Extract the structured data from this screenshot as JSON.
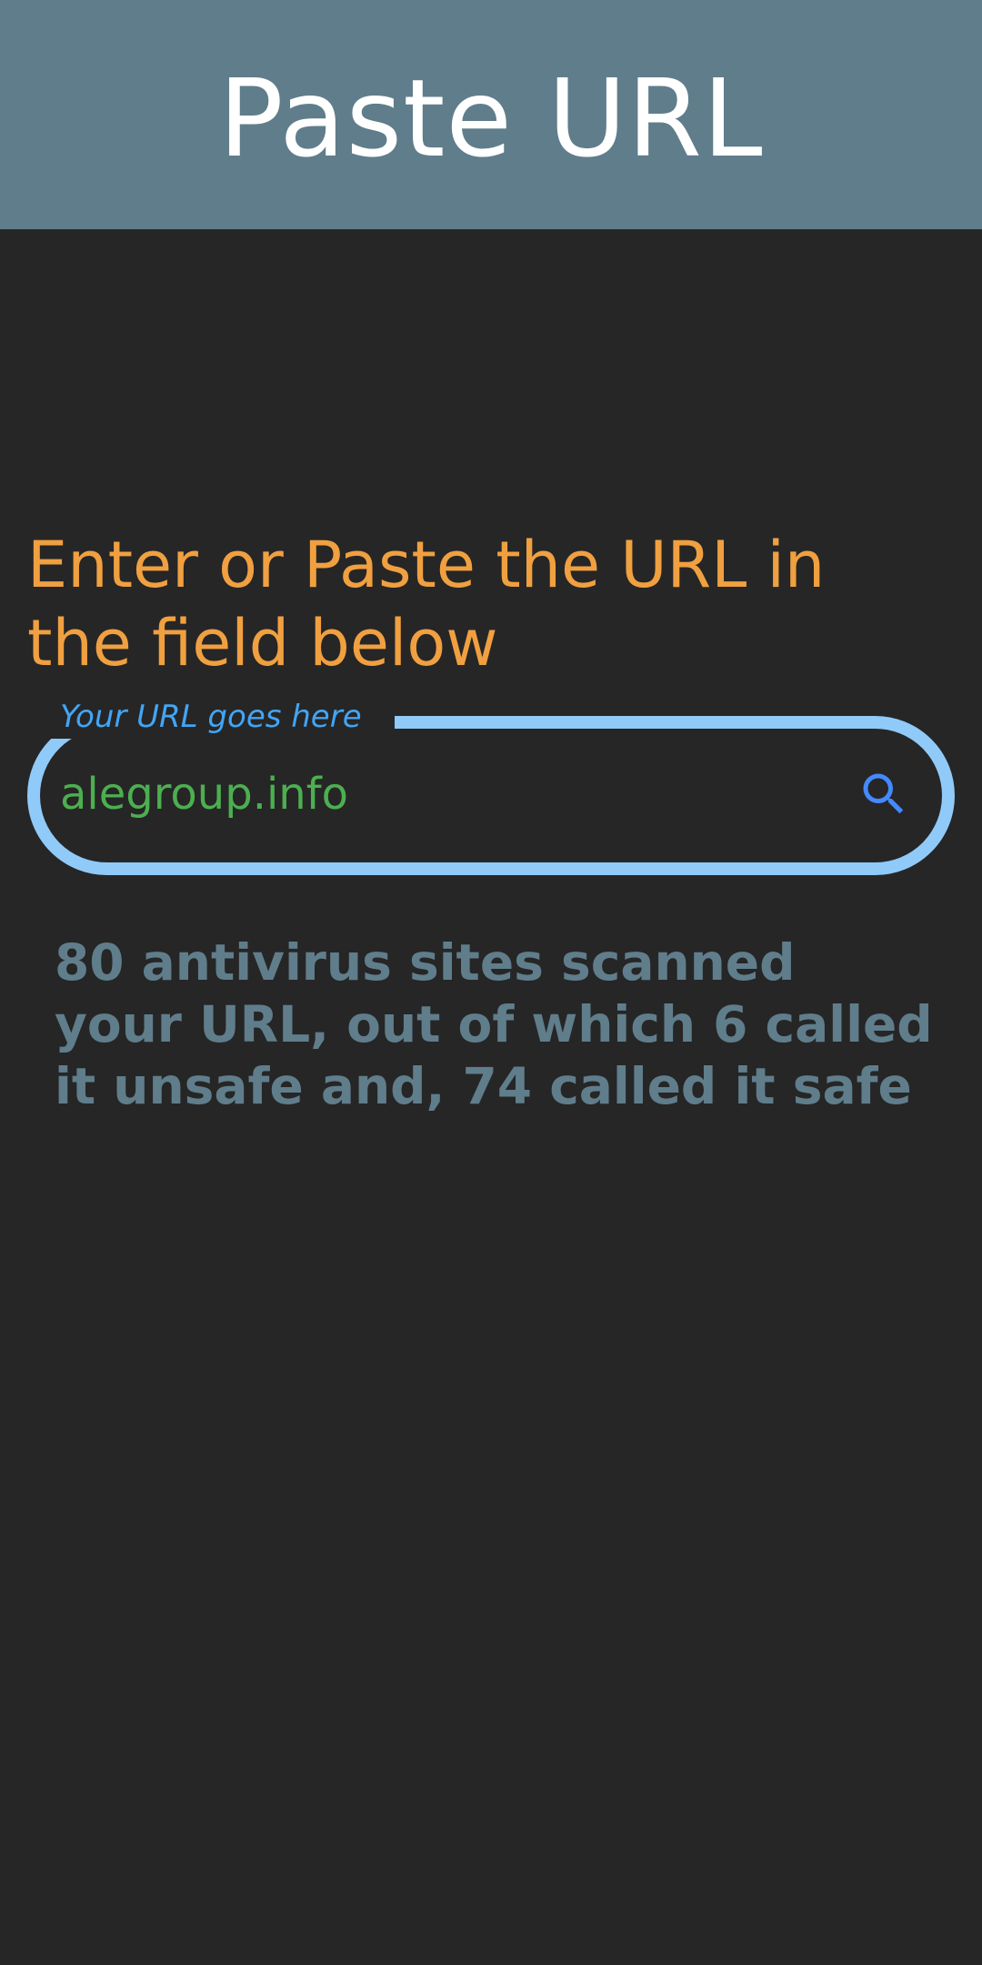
{
  "app_bar": {
    "title": "Paste URL"
  },
  "main": {
    "instruction": "Enter or Paste the URL in the field below",
    "url_field": {
      "label": "Your URL goes here",
      "value": "alegroup.info",
      "search_icon": "search-icon"
    },
    "result": "80 antivirus sites scanned your URL, out of which 6 called it unsafe and, 74 called it safe"
  },
  "colors": {
    "app_bar_bg": "#607d8b",
    "background": "#262626",
    "instruction": "#f0a040",
    "field_border": "#90caf9",
    "label": "#42a5f5",
    "input_text": "#4caf50",
    "search_icon": "#448aff",
    "result_text": "#607d8b"
  }
}
